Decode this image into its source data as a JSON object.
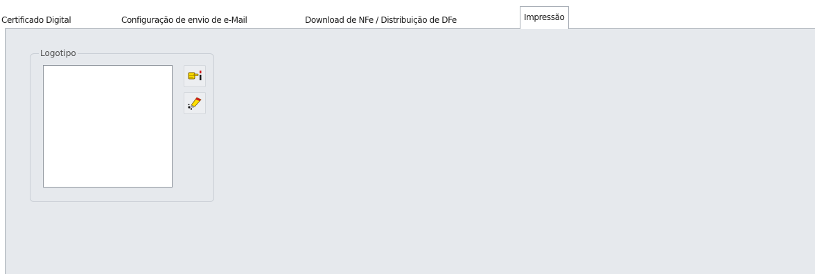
{
  "tabs": [
    {
      "label": "Certificado Digital",
      "active": false
    },
    {
      "label": "Configuração de envio de e-Mail",
      "active": false
    },
    {
      "label": "Download de NFe / Distribuição de DFe",
      "active": false
    },
    {
      "label": "Impressão",
      "active": true
    }
  ],
  "logo_group": {
    "label": "Logotipo",
    "buttons": [
      {
        "icon": "load-image-icon"
      },
      {
        "icon": "clear-image-icon"
      }
    ]
  },
  "colors": {
    "panel_bg": "#e6e9ed",
    "border": "#a7adb5",
    "icon_yellow": "#ffe000",
    "icon_red": "#d01818"
  }
}
